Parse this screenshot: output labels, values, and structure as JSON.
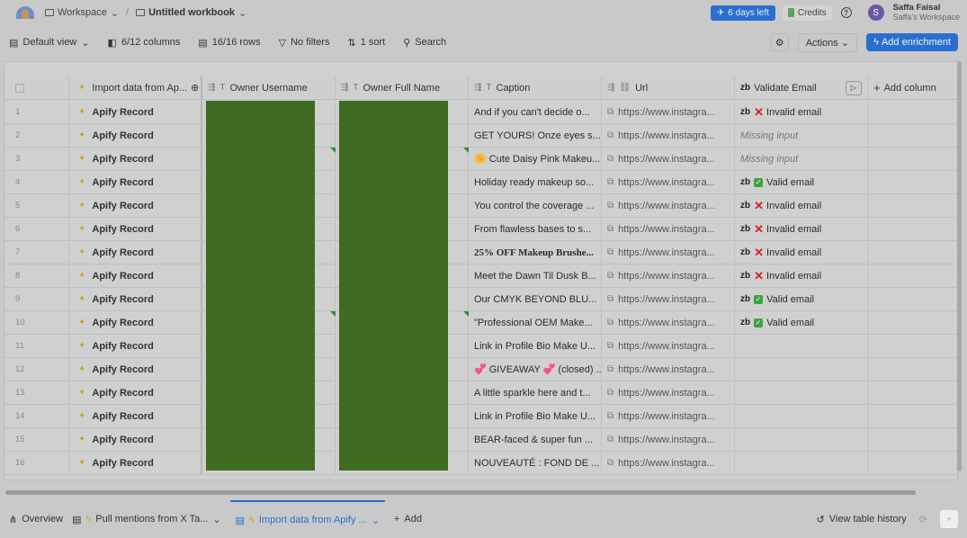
{
  "topbar": {
    "workspace": "Workspace",
    "workbook": "Untitled workbook",
    "days_left": "6 days left",
    "credits": "Credits",
    "user_initial": "S",
    "user_name": "Saffa Faisal",
    "user_workspace": "Saffa's Workspace"
  },
  "toolbar": {
    "view": "Default view",
    "columns": "6/12 columns",
    "rows": "16/16 rows",
    "filters": "No filters",
    "sort": "1 sort",
    "search": "Search",
    "actions": "Actions",
    "add_enrichment": "Add enrichment"
  },
  "columns": [
    "Import data from Ap...",
    "Owner Username",
    "Owner Full Name",
    "Caption",
    "Url",
    "Validate Email",
    "Add column"
  ],
  "rows": [
    {
      "n": "1",
      "rec": "Apify Record",
      "caption": "And if you can't decide o...",
      "url": "https://www.instagra...",
      "email": "Invalid email",
      "status": "invalid"
    },
    {
      "n": "2",
      "rec": "Apify Record",
      "caption": "GET YOURS! Onze eyes s...",
      "url": "https://www.instagra...",
      "email": "Missing input",
      "status": "missing"
    },
    {
      "n": "3",
      "rec": "Apify Record",
      "caption": "🌼 Cute Daisy Pink Makeu...",
      "url": "https://www.instagra...",
      "email": "Missing input",
      "status": "missing"
    },
    {
      "n": "4",
      "rec": "Apify Record",
      "caption": "Holiday ready makeup so...",
      "url": "https://www.instagra...",
      "email": "Valid email",
      "status": "valid"
    },
    {
      "n": "5",
      "rec": "Apify Record",
      "caption": "You control the coverage ...",
      "url": "https://www.instagra...",
      "email": "Invalid email",
      "status": "invalid"
    },
    {
      "n": "6",
      "rec": "Apify Record",
      "caption": "From flawless bases to s...",
      "url": "https://www.instagra...",
      "email": "Invalid email",
      "status": "invalid"
    },
    {
      "n": "7",
      "rec": "Apify Record",
      "caption": "25% OFF Makeup Brushe...",
      "url": "https://www.instagra...",
      "email": "Invalid email",
      "status": "invalid"
    },
    {
      "n": "8",
      "rec": "Apify Record",
      "caption": "Meet the Dawn Til Dusk B...",
      "url": "https://www.instagra...",
      "email": "Invalid email",
      "status": "invalid"
    },
    {
      "n": "9",
      "rec": "Apify Record",
      "caption": "Our CMYK BEYOND BLU...",
      "url": "https://www.instagra...",
      "email": "Valid email",
      "status": "valid"
    },
    {
      "n": "10",
      "rec": "Apify Record",
      "caption": "\"Professional OEM Make...",
      "url": "https://www.instagra...",
      "email": "Valid email",
      "status": "valid"
    },
    {
      "n": "11",
      "rec": "Apify Record",
      "caption": "Link in Profile Bio Make U...",
      "url": "https://www.instagra...",
      "email": "",
      "status": "none"
    },
    {
      "n": "12",
      "rec": "Apify Record",
      "caption": "💞 GIVEAWAY 💞 (closed) ...",
      "url": "https://www.instagra...",
      "email": "",
      "status": "none"
    },
    {
      "n": "13",
      "rec": "Apify Record",
      "caption": "A little sparkle here and t...",
      "url": "https://www.instagra...",
      "email": "",
      "status": "none"
    },
    {
      "n": "14",
      "rec": "Apify Record",
      "caption": "Link in Profile Bio Make U...",
      "url": "https://www.instagra...",
      "email": "",
      "status": "none"
    },
    {
      "n": "15",
      "rec": "Apify Record",
      "caption": "BEAR-faced & super fun ...",
      "url": "https://www.instagra...",
      "email": "",
      "status": "none"
    },
    {
      "n": "16",
      "rec": "Apify Record",
      "caption": "NOUVEAUTÉ : FOND DE ...",
      "url": "https://www.instagra...",
      "email": "",
      "status": "none"
    }
  ],
  "bottombar": {
    "overview": "Overview",
    "tab1": "Pull mentions from X Ta...",
    "tab2": "Import data from Apify ...",
    "add": "Add",
    "history": "View table history"
  },
  "colors": {
    "accent": "#2a6fcf",
    "redacted_block": "#3f6b22",
    "invalid": "#d32020",
    "valid": "#3fa33f"
  }
}
